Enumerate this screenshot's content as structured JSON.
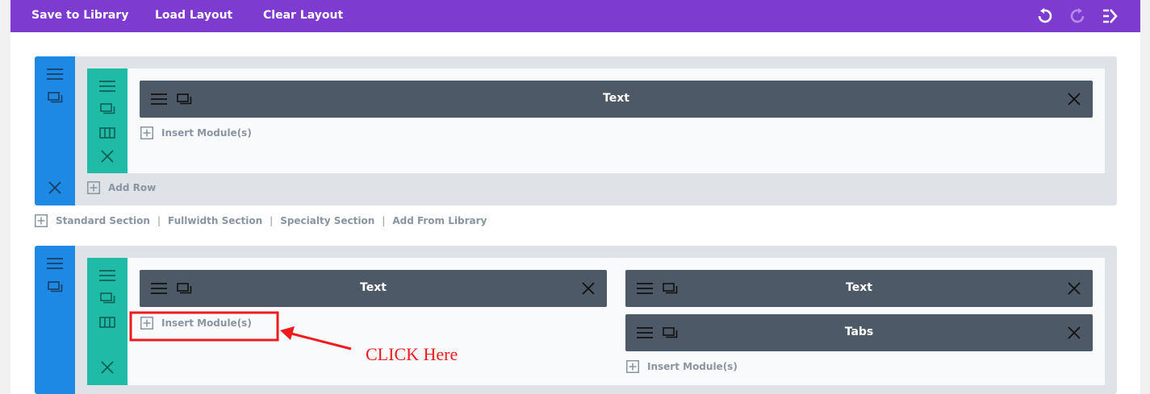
{
  "toolbar": {
    "save_label": "Save to Library",
    "load_label": "Load Layout",
    "clear_label": "Clear Layout",
    "icons": [
      "undo-icon",
      "redo-icon",
      "portability-icon"
    ]
  },
  "sections": [
    {
      "rows": [
        {
          "columns": [
            {
              "modules": [
                {
                  "title": "Text"
                }
              ],
              "insert_label": "Insert Module(s)"
            }
          ]
        }
      ],
      "add_row_label": "Add Row"
    },
    {
      "rows": [
        {
          "columns": [
            {
              "modules": [
                {
                  "title": "Text"
                }
              ],
              "insert_label": "Insert Module(s)"
            },
            {
              "modules": [
                {
                  "title": "Text"
                },
                {
                  "title": "Tabs"
                }
              ],
              "insert_label": "Insert Module(s)"
            }
          ]
        }
      ]
    }
  ],
  "section_links": [
    "Standard Section",
    "Fullwidth Section",
    "Specialty Section",
    "Add From Library"
  ],
  "separator": "|",
  "annotation": {
    "text": "CLICK Here",
    "color": "#ee1c1c"
  },
  "colors": {
    "toolbar": "#7e3bd0",
    "section_handle": "#1e88e5",
    "row_handle": "#1fbba6",
    "module": "#4d5966",
    "section_bg": "#dfe3e8"
  }
}
